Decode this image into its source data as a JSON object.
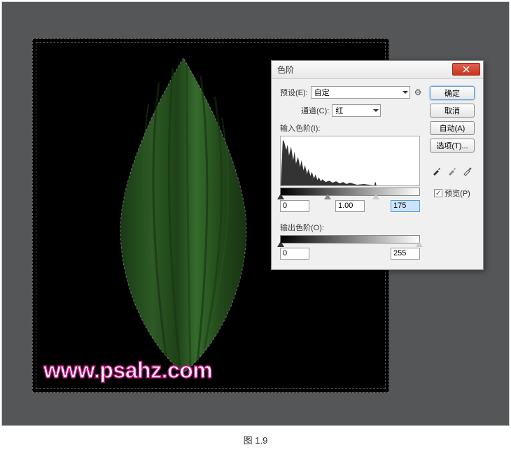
{
  "workspace": {
    "watermark": "www.psahz.com"
  },
  "dialog": {
    "title": "色阶",
    "preset_label": "预设(E):",
    "preset_value": "自定",
    "channel_label": "通道(C):",
    "channel_value": "红",
    "input_levels_label": "输入色阶(I):",
    "output_levels_label": "输出色阶(O):",
    "input_black": "0",
    "input_gamma": "1.00",
    "input_white": "175",
    "output_black": "0",
    "output_white": "255",
    "buttons": {
      "ok": "确定",
      "cancel": "取消",
      "auto": "自动(A)",
      "options": "选项(T)..."
    },
    "preview_label": "预览(P)",
    "preview_checked": true
  },
  "caption": "图 1.9"
}
